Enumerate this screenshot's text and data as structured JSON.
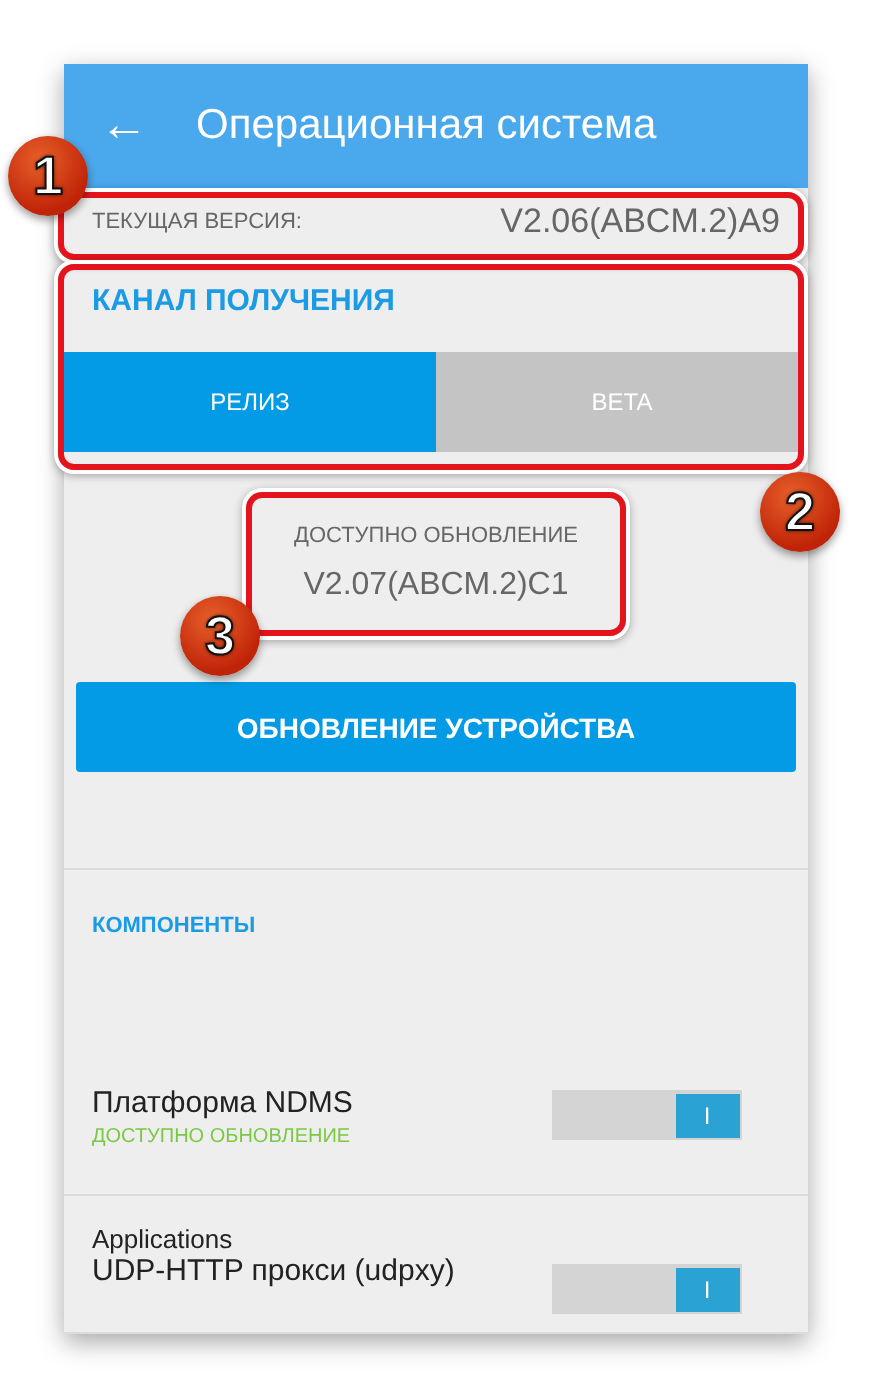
{
  "header": {
    "back_icon": "←",
    "title": "Операционная система"
  },
  "current_version": {
    "label": "ТЕКУЩАЯ ВЕРСИЯ:",
    "value": "V2.06(ABCM.2)A9",
    "callout": "1"
  },
  "channel": {
    "title": "КАНАЛ ПОЛУЧЕНИЯ",
    "callout": "2",
    "options": [
      {
        "label": "РЕЛИЗ",
        "selected": true
      },
      {
        "label": "BETA",
        "selected": false
      }
    ]
  },
  "update": {
    "label": "ДОСТУПНО ОБНОВЛЕНИЕ",
    "version": "V2.07(ABCM.2)C1",
    "callout": "3"
  },
  "update_button": "ОБНОВЛЕНИЕ УСТРОЙСТВА",
  "components": {
    "title": "КОМПОНЕНТЫ",
    "items": [
      {
        "name": "Платформа NDMS",
        "status": "ДОСТУПНО ОБНОВЛЕНИЕ",
        "on": true,
        "toggle_mark": "I"
      },
      {
        "group": "Applications",
        "name": "UDP-HTTP прокси (udpxy)",
        "on": true,
        "toggle_mark": "I"
      }
    ]
  }
}
